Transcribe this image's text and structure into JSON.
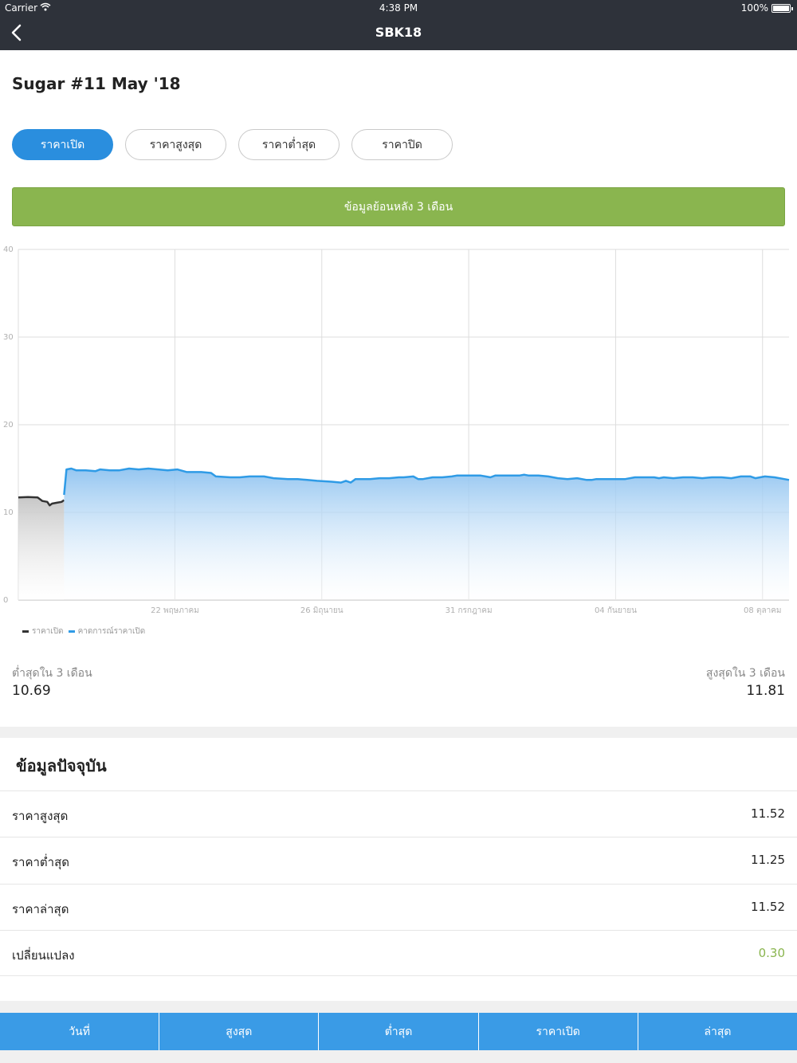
{
  "status_bar": {
    "carrier": "Carrier",
    "time": "4:38 PM",
    "battery": "100%"
  },
  "nav": {
    "title": "SBK18",
    "back_icon": "chevron-left-icon"
  },
  "title": "Sugar #11 May '18",
  "tabs": [
    {
      "label": "ราคาเปิด",
      "active": true
    },
    {
      "label": "ราคาสูงสุด",
      "active": false
    },
    {
      "label": "ราคาต่ำสุด",
      "active": false
    },
    {
      "label": "ราคาปิด",
      "active": false
    }
  ],
  "range_button": "ข้อมูลย้อนหลัง 3 เดือน",
  "colors": {
    "accent": "#2a8ede",
    "green": "#8ab54f",
    "change_positive": "#8ab54f",
    "actual_series": "#333333",
    "forecast_series": "#2f9be6"
  },
  "chart_data": {
    "type": "area",
    "ylim": [
      0,
      40
    ],
    "yticks": [
      0,
      10,
      20,
      30,
      40
    ],
    "xlim": [
      0,
      160
    ],
    "xticks": [
      {
        "x": 32.5,
        "label": "22 พฤษภาคม"
      },
      {
        "x": 63,
        "label": "26 มิถุนายน"
      },
      {
        "x": 93.5,
        "label": "31 กรกฎาคม"
      },
      {
        "x": 124,
        "label": "04 กันยายน"
      },
      {
        "x": 154.5,
        "label": "08 ตุลาคม"
      }
    ],
    "grid": true,
    "legend_position": "bottom-left",
    "series": [
      {
        "name": "ราคาเปิด",
        "values": [
          [
            0,
            11.7
          ],
          [
            2,
            11.75
          ],
          [
            4,
            11.7
          ],
          [
            5,
            11.3
          ],
          [
            6,
            11.2
          ],
          [
            6.5,
            10.8
          ],
          [
            7,
            11.0
          ],
          [
            8,
            11.1
          ],
          [
            9,
            11.2
          ],
          [
            9.5,
            11.4
          ]
        ]
      },
      {
        "name": "คาดการณ์ราคาเปิด",
        "values": [
          [
            9.5,
            12.0
          ],
          [
            10,
            14.9
          ],
          [
            11,
            15.0
          ],
          [
            12,
            14.8
          ],
          [
            14,
            14.8
          ],
          [
            16,
            14.7
          ],
          [
            17,
            14.9
          ],
          [
            19,
            14.8
          ],
          [
            21,
            14.8
          ],
          [
            23,
            15.0
          ],
          [
            25,
            14.9
          ],
          [
            27,
            15.0
          ],
          [
            29,
            14.9
          ],
          [
            31,
            14.8
          ],
          [
            33,
            14.9
          ],
          [
            35,
            14.6
          ],
          [
            38,
            14.6
          ],
          [
            40,
            14.5
          ],
          [
            41,
            14.1
          ],
          [
            44,
            14.0
          ],
          [
            46,
            14.0
          ],
          [
            48,
            14.1
          ],
          [
            51,
            14.1
          ],
          [
            53,
            13.9
          ],
          [
            56,
            13.8
          ],
          [
            58,
            13.8
          ],
          [
            60,
            13.7
          ],
          [
            62,
            13.6
          ],
          [
            65,
            13.5
          ],
          [
            67,
            13.4
          ],
          [
            68,
            13.6
          ],
          [
            69,
            13.4
          ],
          [
            70,
            13.8
          ],
          [
            73,
            13.8
          ],
          [
            75,
            13.9
          ],
          [
            77,
            13.9
          ],
          [
            79,
            14.0
          ],
          [
            80,
            14.0
          ],
          [
            82,
            14.1
          ],
          [
            83,
            13.8
          ],
          [
            84,
            13.8
          ],
          [
            86,
            14.0
          ],
          [
            88,
            14.0
          ],
          [
            90,
            14.1
          ],
          [
            91,
            14.2
          ],
          [
            94,
            14.2
          ],
          [
            96,
            14.2
          ],
          [
            97,
            14.1
          ],
          [
            98,
            14.0
          ],
          [
            99,
            14.2
          ],
          [
            102,
            14.2
          ],
          [
            104,
            14.2
          ],
          [
            105,
            14.3
          ],
          [
            106,
            14.2
          ],
          [
            108,
            14.2
          ],
          [
            110,
            14.1
          ],
          [
            112,
            13.9
          ],
          [
            114,
            13.8
          ],
          [
            116,
            13.9
          ],
          [
            118,
            13.7
          ],
          [
            119,
            13.7
          ],
          [
            120,
            13.8
          ],
          [
            122,
            13.8
          ],
          [
            124,
            13.8
          ],
          [
            126,
            13.8
          ],
          [
            128,
            14.0
          ],
          [
            130,
            14.0
          ],
          [
            132,
            14.0
          ],
          [
            133,
            13.9
          ],
          [
            134,
            14.0
          ],
          [
            136,
            13.9
          ],
          [
            138,
            14.0
          ],
          [
            140,
            14.0
          ],
          [
            142,
            13.9
          ],
          [
            144,
            14.0
          ],
          [
            146,
            14.0
          ],
          [
            148,
            13.9
          ],
          [
            150,
            14.1
          ],
          [
            152,
            14.1
          ],
          [
            153,
            13.9
          ],
          [
            155,
            14.1
          ],
          [
            157,
            14.0
          ],
          [
            159,
            13.8
          ],
          [
            160,
            13.7
          ]
        ]
      }
    ]
  },
  "stats": {
    "min_label": "ต่ำสุดใน 3 เดือน",
    "min_value": "10.69",
    "max_label": "สูงสุดใน 3 เดือน",
    "max_value": "11.81"
  },
  "current": {
    "title": "ข้อมูลปัจจุบัน",
    "rows": [
      {
        "label": "ราคาสูงสุด",
        "value": "11.52"
      },
      {
        "label": "ราคาต่ำสุด",
        "value": "11.25"
      },
      {
        "label": "ราคาล่าสุด",
        "value": "11.52"
      },
      {
        "label": "เปลี่ยนแปลง",
        "value": "0.30"
      }
    ]
  },
  "table_header": [
    "วันที่",
    "สูงสุด",
    "ต่ำสุด",
    "ราคาเปิด",
    "ล่าสุด"
  ]
}
